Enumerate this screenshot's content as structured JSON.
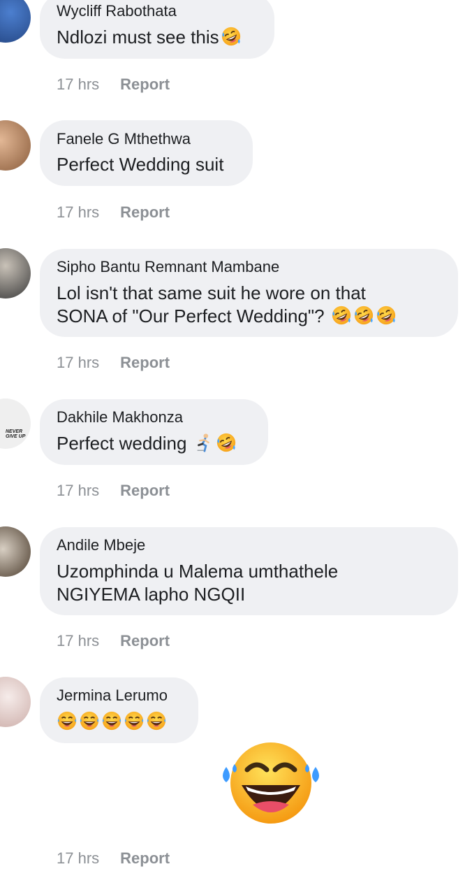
{
  "comments": [
    {
      "author": "Wycliff Rabothata",
      "text": "Ndlozi must see this",
      "emojis": [
        "rofl-icon"
      ],
      "time": "17 hrs",
      "report": "Report",
      "avatar_color": "#2f5fa7"
    },
    {
      "author": "Fanele G Mthethwa",
      "text": "Perfect Wedding suit",
      "emojis": [],
      "time": "17 hrs",
      "report": "Report",
      "avatar_color": "#c59a78"
    },
    {
      "author": "Sipho Bantu Remnant Mambane",
      "text_line1": "Lol isn't that same suit he wore on that",
      "text_line2": "SONA of \"Our Perfect Wedding\"?",
      "emojis": [
        "rofl-icon",
        "rofl-icon",
        "rofl-icon"
      ],
      "time": "17 hrs",
      "report": "Report",
      "avatar_color": "#4a4f58"
    },
    {
      "author": "Dakhile Makhonza",
      "text": "Perfect wedding",
      "emojis": [
        "runner-icon",
        "rofl-icon"
      ],
      "time": "17 hrs",
      "report": "Report",
      "avatar_color": "#d9d9d9",
      "avatar_text": "NEVER GIVE UP"
    },
    {
      "author": "Andile Mbeje",
      "text_line1": "Uzomphinda u Malema umthathele",
      "text_line2": "NGIYEMA lapho NGQII",
      "emojis": [],
      "time": "17 hrs",
      "report": "Report",
      "avatar_color": "#5a4a38"
    },
    {
      "author": "Jermina Lerumo",
      "text": "",
      "emojis": [
        "tears-of-joy-icon",
        "tears-of-joy-icon",
        "tears-of-joy-icon",
        "tears-of-joy-icon",
        "tears-of-joy-icon"
      ],
      "sticker": "tears-of-joy-sticker",
      "time": "17 hrs",
      "report": "Report",
      "avatar_color": "#e9d7d4"
    }
  ]
}
